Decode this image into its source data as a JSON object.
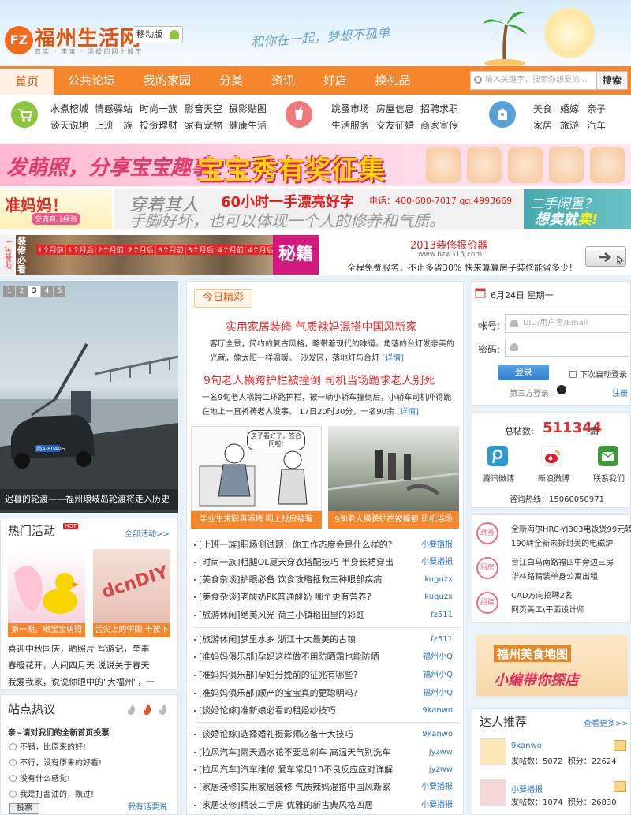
{
  "header": {
    "logo_badge": "FZ",
    "logo_text": "福州生活网",
    "logo_sub": "真实 · 丰富 · 温暖的网上城市",
    "mobile_label": "移动版",
    "slogan": "和你在一起，梦想不孤单"
  },
  "nav": {
    "items": [
      "首页",
      "公共论坛",
      "我的家园",
      "分类",
      "资讯",
      "好店",
      "换礼品"
    ],
    "active_index": 0,
    "search_placeholder": "输入关键字，搜索你想要的...",
    "search_button": "搜索"
  },
  "categories": {
    "group1": [
      "水煮榕城",
      "情感驿站",
      "时尚一族",
      "影音天空",
      "摄影贴图",
      "谈天说地",
      "上班一族",
      "投资理财",
      "家有宠物",
      "健康生活"
    ],
    "group2": [
      "跳蚤市场",
      "房屋信息",
      "招聘求职",
      "生活服务",
      "交友征婚",
      "商家宣传"
    ],
    "group3": [
      "美食",
      "婚嫁",
      "亲子",
      "家居",
      "旅游",
      "汽车"
    ]
  },
  "banner1": {
    "left_text": "发萌照，分享宝宝趣事",
    "main_text": "宝宝秀有奖征集"
  },
  "banner2": {
    "left_title": "准妈妈！",
    "left_sub": "交流育儿经验",
    "hand_line1": "穿着其人",
    "hand_line2": "手脚好坏，也可以体现一个人的修养和气质。",
    "red_text": "60小时一手漂亮好字",
    "phone_text": "电话：400-600-7017 qq:4993669",
    "right_line1": "二手闲置？",
    "right_line2_pre": "想卖就",
    "right_line2_em": "卖!"
  },
  "banner3": {
    "ad_tag": "广告赞助",
    "left_label": "装修必看",
    "months": [
      "1个月前",
      "1个月后",
      "2个月前",
      "2个月后",
      "3个月前",
      "3个月后",
      "4个月前",
      "4个月后"
    ],
    "secret": "秘籍",
    "title": "2013装修报价器",
    "url": "www.bzw315.com",
    "desc": "全程免费服务，不止多省30% 快来算算房子装修能省多少！"
  },
  "slideshow": {
    "pages": [
      "1",
      "2",
      "3",
      "4",
      "5"
    ],
    "active_page": 2,
    "plate": "闽A·8040S",
    "caption": "迟暮的轮渡——福州琅岐岛轮渡将走入历史"
  },
  "hot_activities": {
    "title": "热门活动",
    "badge": "HOT",
    "more": "全部活动>>",
    "cards": [
      {
        "caption": "第一期，晒宝宝萌照"
      },
      {
        "caption": "舌尖上的中国 十按下"
      }
    ],
    "card2_art": "dcnDIY",
    "lines": [
      "喜迎中秋国庆，晒照片 写游记，奎丰",
      "春暖花开，人间四月天 说说关于春天",
      "我爱我家，说说你眼中的\"大福州\"，一"
    ]
  },
  "poll": {
    "title": "站点热议",
    "question": "亲~请对我们的全新首页投票",
    "options": [
      "不错，比原来的好!",
      "不行，没有原来的好看!",
      "没有什么感觉!",
      "我是打酱油的，飘过!"
    ],
    "vote_button": "投票",
    "speak_link": "我有话要说"
  },
  "today": {
    "tab": "今日精彩",
    "headline1": "实用家居装修 气质辣妈混搭中国风新家",
    "summary1": "客厅全景，简约的复古风格，略带着现代的味道。角落的台灯发亲美的光就，像太阳一样温暖。　沙发区，落地灯与台灯",
    "more1": "[详情]",
    "headline2": "9旬老人横跨护栏被撞倒 司机当场跪求老人别死",
    "summary2": "一名9旬老人横跨二环路护栏，被一辆小轿车撞倒后，小轿车司机吓得跪在地上一直祈祷老人没事。 17日20时30分，一名90余",
    "more2": "[详情]",
    "cartoon_bubble": "房子看好了，签合同啦!",
    "img_caps": [
      "毕业生求职再添堵 网上找房被骗",
      "9旬老人横跨护栏被撞倒 司机当场"
    ]
  },
  "news_group1": [
    {
      "title": "[上班一族]职场测试题：你工作态度会是什么样的?",
      "author": "小要播报"
    },
    {
      "title": "[时尚一族]粗腿OL夏天穿衣搭配技巧 半身长裙穿出",
      "author": "小要播报"
    },
    {
      "title": "[美食杂谈]护眼必备 饮食攻略拯救三种眼部疾病",
      "author": "kuguzx"
    },
    {
      "title": "[美食杂谈]老酸奶PK普通酸奶 哪个更有营养?",
      "author": "kuguzx"
    },
    {
      "title": "[旅游休闲]绝美风光 荷兰小镇稻田里的彩虹",
      "author": "fz511"
    }
  ],
  "news_group2": [
    {
      "title": "[旅游休闲]梦里水乡 浙江十大最美的古镇",
      "author": "fz511"
    },
    {
      "title": "[准妈妈俱乐部]孕妈这样做不用防晒霜也能防晒",
      "author": "福州小Q"
    },
    {
      "title": "[准妈妈俱乐部]孕妇分娩前的征兆有哪些?",
      "author": "福州小Q"
    },
    {
      "title": "[准妈妈俱乐部]顺产的宝宝真的更聪明吗?",
      "author": "福州小Q"
    },
    {
      "title": "[谈婚论嫁]准新娘必看的租婚纱技巧",
      "author": "9kanwo"
    }
  ],
  "news_group3": [
    {
      "title": "[谈婚论嫁]选择婚礼摄影师必备十大技巧",
      "author": "9kanwo"
    },
    {
      "title": "[拉风汽车]雨天遇水花不要急刹车 高温天气别洗车",
      "author": "jyzww"
    },
    {
      "title": "[拉风汽车]汽车维修 爱车常见10不良反应应对详解",
      "author": "jyzww"
    },
    {
      "title": "[家居装修]实用家居装修 气质辣妈混搭中国风新家",
      "author": "小要播报"
    },
    {
      "title": "[家居装修]精装二手房 优雅的新古典风格四居",
      "author": "小要播报"
    }
  ],
  "login": {
    "date": "6月24日 星期一",
    "account_label": "帐号:",
    "account_placeholder": "UID/用户名/Email",
    "password_label": "密码:",
    "login_button": "登录",
    "auto_login": "下次自动登录",
    "third_party": "第三方登录：",
    "register": "注册"
  },
  "stats": {
    "posts_label": "总帖数:",
    "posts_value": "511344",
    "posts_unit": "篇",
    "social": [
      "腾讯微博",
      "新浪微博",
      "联系我们"
    ],
    "hotline": "咨询热线：15060050971"
  },
  "classifieds": [
    {
      "badge": "跳蚤",
      "lines": [
        "全新海尔HRC-YJ303电饭煲99元转",
        "190转全新未拆封美的电磁炉"
      ]
    },
    {
      "badge": "租房",
      "lines": [
        "台江白马南路福四中旁边三房",
        "华林路精装单身公寓出租"
      ]
    },
    {
      "badge": "招聘",
      "lines": [
        "CAD方向招聘2名",
        "网页美工\\平面设计师"
      ]
    }
  ],
  "food_banner": {
    "t1": "福州美食地图",
    "t2": "小编带你探店"
  },
  "talents": {
    "title": "达人推荐",
    "more": "查看更多>>",
    "people": [
      {
        "name": "9kanwo",
        "posts": "发帖数：5072",
        "points": "积分：22624"
      },
      {
        "name": "小要播报",
        "posts": "发帖数：1074",
        "points": "积分：26830"
      }
    ]
  }
}
